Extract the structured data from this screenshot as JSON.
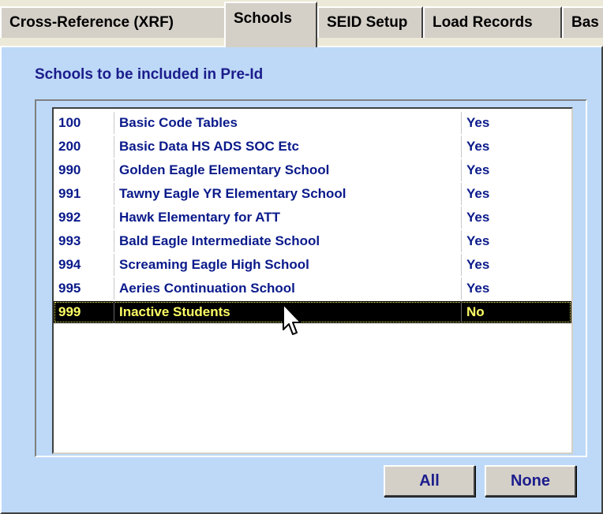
{
  "tabs": [
    {
      "label": "Cross-Reference (XRF)",
      "active": false
    },
    {
      "label": "Schools",
      "active": true
    },
    {
      "label": "SEID Setup",
      "active": false
    },
    {
      "label": "Load Records",
      "active": false
    },
    {
      "label": "Bas",
      "active": false
    }
  ],
  "panel": {
    "title": "Schools to be included in Pre-Id"
  },
  "schools": [
    {
      "code": "100",
      "name": "Basic Code Tables",
      "included": "Yes",
      "selected": false
    },
    {
      "code": "200",
      "name": "Basic Data HS ADS SOC Etc",
      "included": "Yes",
      "selected": false
    },
    {
      "code": "990",
      "name": "Golden Eagle Elementary School",
      "included": "Yes",
      "selected": false
    },
    {
      "code": "991",
      "name": "Tawny Eagle YR Elementary School",
      "included": "Yes",
      "selected": false
    },
    {
      "code": "992",
      "name": "Hawk Elementary for ATT",
      "included": "Yes",
      "selected": false
    },
    {
      "code": "993",
      "name": "Bald Eagle Intermediate School",
      "included": "Yes",
      "selected": false
    },
    {
      "code": "994",
      "name": "Screaming Eagle High School",
      "included": "Yes",
      "selected": false
    },
    {
      "code": "995",
      "name": "Aeries Continuation School",
      "included": "Yes",
      "selected": false
    },
    {
      "code": "999",
      "name": "Inactive Students",
      "included": "No",
      "selected": true
    }
  ],
  "buttons": {
    "all_label": "All",
    "none_label": "None"
  },
  "colors": {
    "panel_background": "#bdd9f7",
    "list_text": "#0a1a8a",
    "selected_row_background": "#000000",
    "selected_row_text": "#ffff66"
  }
}
